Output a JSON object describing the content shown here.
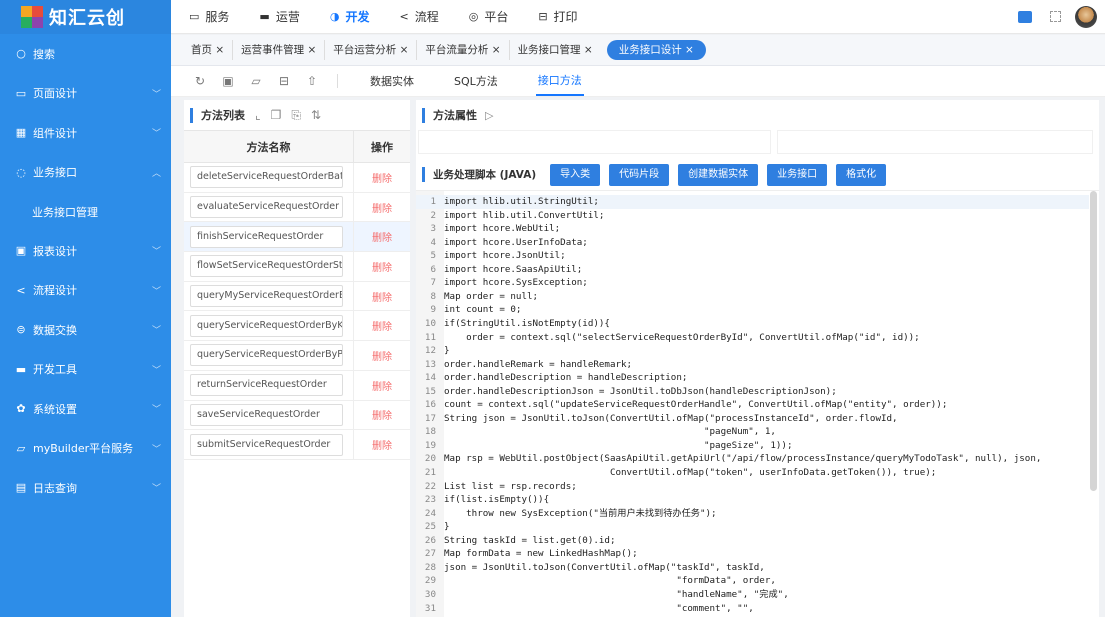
{
  "app": {
    "logo_text": "知汇云创"
  },
  "sidebar": {
    "items": [
      {
        "label": "搜索",
        "icon": "search-icon"
      },
      {
        "label": "页面设计",
        "icon": "page-icon"
      },
      {
        "label": "组件设计",
        "icon": "grid-icon"
      },
      {
        "label": "业务接口",
        "icon": "api-icon",
        "expanded": true
      },
      {
        "label": "报表设计",
        "icon": "report-icon"
      },
      {
        "label": "流程设计",
        "icon": "flow-icon"
      },
      {
        "label": "数据交换",
        "icon": "exchange-icon"
      },
      {
        "label": "开发工具",
        "icon": "tools-icon"
      },
      {
        "label": "系统设置",
        "icon": "gear-icon"
      },
      {
        "label": "myBuilder平台服务",
        "icon": "service-icon"
      },
      {
        "label": "日志查询",
        "icon": "log-icon"
      }
    ],
    "sub_item": "业务接口管理"
  },
  "topnav": {
    "items": [
      {
        "label": "服务",
        "icon": "service-icon"
      },
      {
        "label": "运营",
        "icon": "operate-icon"
      },
      {
        "label": "开发",
        "icon": "develop-icon",
        "active": true
      },
      {
        "label": "流程",
        "icon": "flow-icon"
      },
      {
        "label": "平台",
        "icon": "platform-icon"
      },
      {
        "label": "打印",
        "icon": "print-icon"
      }
    ]
  },
  "tabs": [
    {
      "label": "首页 ×"
    },
    {
      "label": "运营事件管理 ×"
    },
    {
      "label": "平台运营分析 ×"
    },
    {
      "label": "平台流量分析 ×"
    },
    {
      "label": "业务接口管理 ×"
    },
    {
      "label": "业务接口设计 ×",
      "active": true
    }
  ],
  "toolbar": {
    "tabs": [
      {
        "label": "数据实体"
      },
      {
        "label": "SQL方法"
      },
      {
        "label": "接口方法",
        "active": true
      }
    ]
  },
  "method_panel": {
    "title": "方法列表",
    "col_name": "方法名称",
    "col_op": "操作",
    "rows": [
      {
        "name": "deleteServiceRequestOrderBatch",
        "op": "删除"
      },
      {
        "name": "evaluateServiceRequestOrder",
        "op": "删除"
      },
      {
        "name": "finishServiceRequestOrder",
        "op": "删除",
        "selected": true
      },
      {
        "name": "flowSetServiceRequestOrderState",
        "op": "删除"
      },
      {
        "name": "queryMyServiceRequestOrderByPage",
        "op": "删除"
      },
      {
        "name": "queryServiceRequestOrderByKey",
        "op": "删除"
      },
      {
        "name": "queryServiceRequestOrderByPage",
        "op": "删除"
      },
      {
        "name": "returnServiceRequestOrder",
        "op": "删除"
      },
      {
        "name": "saveServiceRequestOrder",
        "op": "删除"
      },
      {
        "name": "submitServiceRequestOrder",
        "op": "删除"
      }
    ]
  },
  "props_panel": {
    "title": "方法属性"
  },
  "script": {
    "title": "业务处理脚本 (JAVA)",
    "buttons": [
      "导入类",
      "代码片段",
      "创建数据实体",
      "业务接口",
      "格式化"
    ],
    "lines": [
      "import hlib.util.StringUtil;",
      "import hlib.util.ConvertUtil;",
      "import hcore.WebUtil;",
      "import hcore.UserInfoData;",
      "import hcore.JsonUtil;",
      "import hcore.SaasApiUtil;",
      "import hcore.SysException;",
      "Map order = null;",
      "int count = 0;",
      "if(StringUtil.isNotEmpty(id)){",
      "    order = context.sql(\"selectServiceRequestOrderById\", ConvertUtil.ofMap(\"id\", id));",
      "}",
      "order.handleRemark = handleRemark;",
      "order.handleDescription = handleDescription;",
      "order.handleDescriptionJson = JsonUtil.toDbJson(handleDescriptionJson);",
      "count = context.sql(\"updateServiceRequestOrderHandle\", ConvertUtil.ofMap(\"entity\", order));",
      "String json = JsonUtil.toJson(ConvertUtil.ofMap(\"processInstanceId\", order.flowId,",
      "                                               \"pageNum\", 1,",
      "                                               \"pageSize\", 1));",
      "Map rsp = WebUtil.postObject(SaasApiUtil.getApiUrl(\"/api/flow/processInstance/queryMyTodoTask\", null), json,",
      "                              ConvertUtil.ofMap(\"token\", userInfoData.getToken()), true);",
      "List list = rsp.records;",
      "if(list.isEmpty()){",
      "    throw new SysException(\"当前用户未找到待办任务\");",
      "}",
      "String taskId = list.get(0).id;",
      "Map formData = new LinkedHashMap();",
      "json = JsonUtil.toJson(ConvertUtil.ofMap(\"taskId\", taskId,",
      "                                          \"formData\", order,",
      "                                          \"handleName\", \"完成\",",
      "                                          \"comment\", \"\","
    ],
    "line_numbers": [
      "1",
      "2",
      "3",
      "4",
      "5",
      "6",
      "7",
      "8",
      "9",
      "10",
      "11",
      "12",
      "13",
      "14",
      "15",
      "16",
      "17",
      "18",
      "19",
      "20",
      "21",
      "22",
      "23",
      "24",
      "25",
      "26",
      "27",
      "28",
      "29",
      "30",
      "31"
    ]
  },
  "colors": {
    "accent": "#2f7fe0",
    "sidebar": "#2d8de8",
    "danger": "#f56c6c"
  }
}
